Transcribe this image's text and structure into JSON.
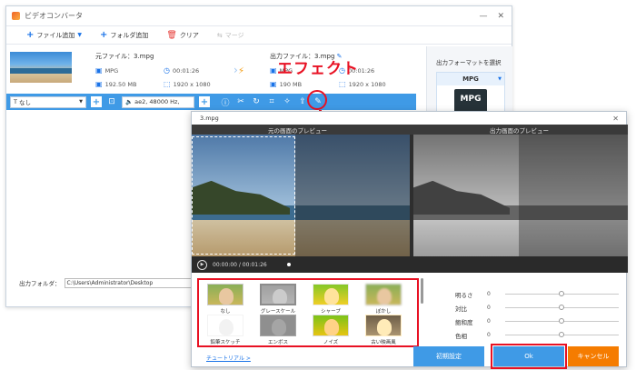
{
  "window": {
    "title": "ビデオコンバータ"
  },
  "toolbar": {
    "add_file": "ファイル追加",
    "add_folder": "フォルダ追加",
    "clear": "クリア",
    "merge": "マージ"
  },
  "file": {
    "src_label": "元ファイル：3.mpg",
    "src_format": "MPG",
    "src_duration": "00:01:26",
    "src_size": "192.50 MB",
    "src_resolution": "1920 x 1080",
    "dst_label": "出力ファイル：3.mpg",
    "dst_format": "MPG",
    "dst_duration": "00:01:26",
    "dst_size": "190 MB",
    "dst_resolution": "1920 x 1080"
  },
  "edit_bar": {
    "subtitle": "なし",
    "audio": "ae2, 48000 Hz,",
    "plus": "+"
  },
  "right_panel": {
    "title": "出力フォーマットを選択",
    "format": "MPG"
  },
  "output": {
    "label": "出力フォルダ：",
    "path": "C:\\Users\\Administrator\\Desktop"
  },
  "annotation": {
    "effect": "エフェクト"
  },
  "dialog": {
    "title": "3.mpg",
    "original_preview": "元の画面のプレビュー",
    "output_preview": "出力画面のプレビュー",
    "time": "00:00:00 / 00:01:26",
    "effects": [
      {
        "label": "なし"
      },
      {
        "label": "グレースケール"
      },
      {
        "label": "シャープ"
      },
      {
        "label": "ぼかし"
      },
      {
        "label": "鉛筆スケッチ"
      },
      {
        "label": "エンボス"
      },
      {
        "label": "ノイズ"
      },
      {
        "label": "古い映画風"
      }
    ],
    "adjust": [
      {
        "label": "明るさ",
        "value": "0"
      },
      {
        "label": "対比",
        "value": "0"
      },
      {
        "label": "飽和度",
        "value": "0"
      },
      {
        "label": "色相",
        "value": "0"
      }
    ],
    "tutorial": "チュートリアル >",
    "reset": "初期設定",
    "ok": "Ok",
    "cancel": "キャンセル"
  }
}
